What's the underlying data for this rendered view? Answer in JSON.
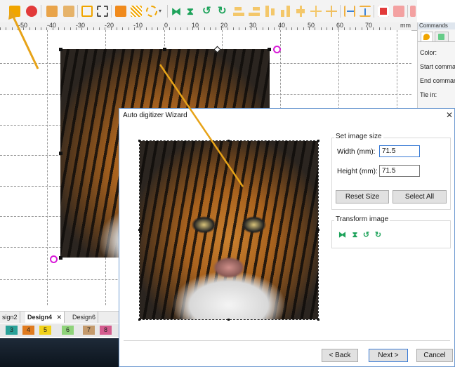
{
  "ruler": {
    "unit": "mm",
    "labels": [
      "-50",
      "-40",
      "-30",
      "-20",
      "-10",
      "0",
      "10",
      "20",
      "30",
      "40",
      "50",
      "60",
      "70"
    ]
  },
  "toolbar": {
    "icons": [
      "fill-icon",
      "stitch-icon",
      "color-select-icon",
      "color-sort-icon",
      "rectangle-select-icon",
      "rectangle-dotted-icon",
      "color-blocks-icon",
      "pattern-fill-icon",
      "circle-select-icon",
      "dropdown-icon",
      "mirror-horizontal-icon",
      "mirror-vertical-icon",
      "rotate-left-icon",
      "rotate-right-icon",
      "align-left-icon",
      "align-center-icon",
      "align-top-icon",
      "align-bottom-icon",
      "align-middle-icon",
      "distribute-icon",
      "move-icon",
      "spacing-horizontal-icon",
      "spacing-vertical-icon",
      "group-red-icon",
      "ungroup-red-icon",
      "layer-up-icon",
      "layer-down-icon",
      "layer-extra-icon"
    ]
  },
  "panel": {
    "header": "Commands",
    "rows": [
      "Color:",
      "Start command",
      "End command",
      "Tie in:"
    ]
  },
  "doc_tabs": [
    {
      "label": "sign2",
      "active": false
    },
    {
      "label": "Design4",
      "active": true
    },
    {
      "label": "Design6",
      "active": false
    }
  ],
  "palette": [
    {
      "label": "3",
      "color": "#2aa198"
    },
    {
      "label": "4",
      "color": "#e07b1f"
    },
    {
      "label": "5",
      "color": "#f2d21b"
    },
    {
      "label": "6",
      "color": "#8fd37a"
    },
    {
      "label": "7",
      "color": "#c49a6c"
    },
    {
      "label": "8",
      "color": "#d45d8f"
    }
  ],
  "dialog": {
    "title": "Auto digitizer Wizard",
    "close": "✕",
    "set_image_size": {
      "label": "Set image size",
      "width_label": "Width (mm):",
      "width_value": "71.5",
      "height_label": "Height (mm):",
      "height_value": "71.5",
      "reset_button": "Reset Size",
      "select_all_button": "Select All"
    },
    "transform_image": {
      "label": "Transform image",
      "icons": [
        "mirror-horizontal-icon",
        "mirror-vertical-icon",
        "rotate-left-icon",
        "rotate-right-icon"
      ]
    },
    "back_button": "< Back",
    "next_button": "Next >",
    "cancel_button": "Cancel"
  },
  "colors": {
    "dialog_border": "#6f9bd1",
    "accent_blue": "#3a7bd5",
    "annotation_arrow": "#e7a318",
    "icon_green": "#1ea35b"
  }
}
